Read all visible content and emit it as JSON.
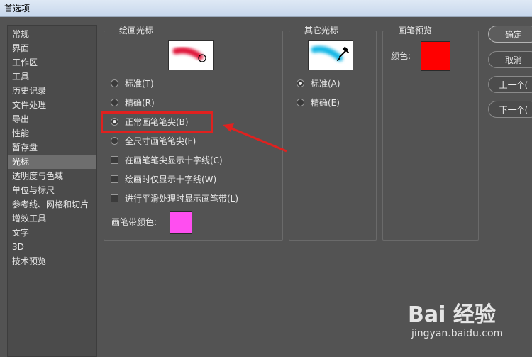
{
  "window": {
    "title": "首选项"
  },
  "sidebar": {
    "items": [
      {
        "label": "常规"
      },
      {
        "label": "界面"
      },
      {
        "label": "工作区"
      },
      {
        "label": "工具"
      },
      {
        "label": "历史记录"
      },
      {
        "label": "文件处理"
      },
      {
        "label": "导出"
      },
      {
        "label": "性能"
      },
      {
        "label": "暂存盘"
      },
      {
        "label": "光标",
        "selected": true
      },
      {
        "label": "透明度与色域"
      },
      {
        "label": "单位与标尺"
      },
      {
        "label": "参考线、网格和切片"
      },
      {
        "label": "增效工具"
      },
      {
        "label": "文字"
      },
      {
        "label": "3D"
      },
      {
        "label": "技术预览"
      }
    ]
  },
  "painting_cursors": {
    "title": "绘画光标",
    "options": [
      {
        "label": "标准(T)",
        "selected": false
      },
      {
        "label": "精确(R)",
        "selected": false
      },
      {
        "label": "正常画笔笔尖(B)",
        "selected": true
      },
      {
        "label": "全尺寸画笔笔尖(F)",
        "selected": false
      }
    ],
    "checkboxes": [
      {
        "label": "在画笔笔尖显示十字线(C)",
        "checked": false
      },
      {
        "label": "绘画时仅显示十字线(W)",
        "checked": false
      },
      {
        "label": "进行平滑处理时显示画笔带(L)",
        "checked": false
      }
    ],
    "brush_leash_label": "画笔带颜色:",
    "brush_leash_color": "#ff4ef0",
    "preview_color": "#e0153a"
  },
  "other_cursors": {
    "title": "其它光标",
    "options": [
      {
        "label": "标准(A)",
        "selected": true
      },
      {
        "label": "精确(E)",
        "selected": false
      }
    ],
    "preview_color": "#19b8e6"
  },
  "brush_preview": {
    "title": "画笔预览",
    "color_label": "颜色:",
    "color": "#ff0000"
  },
  "buttons": {
    "ok": "确定",
    "cancel": "取消",
    "prev": "上一个(",
    "next": "下一个("
  },
  "annotation": {
    "color": "#e0211f"
  },
  "watermark": {
    "logo": "Bai 经验",
    "url": "jingyan.baidu.com"
  }
}
